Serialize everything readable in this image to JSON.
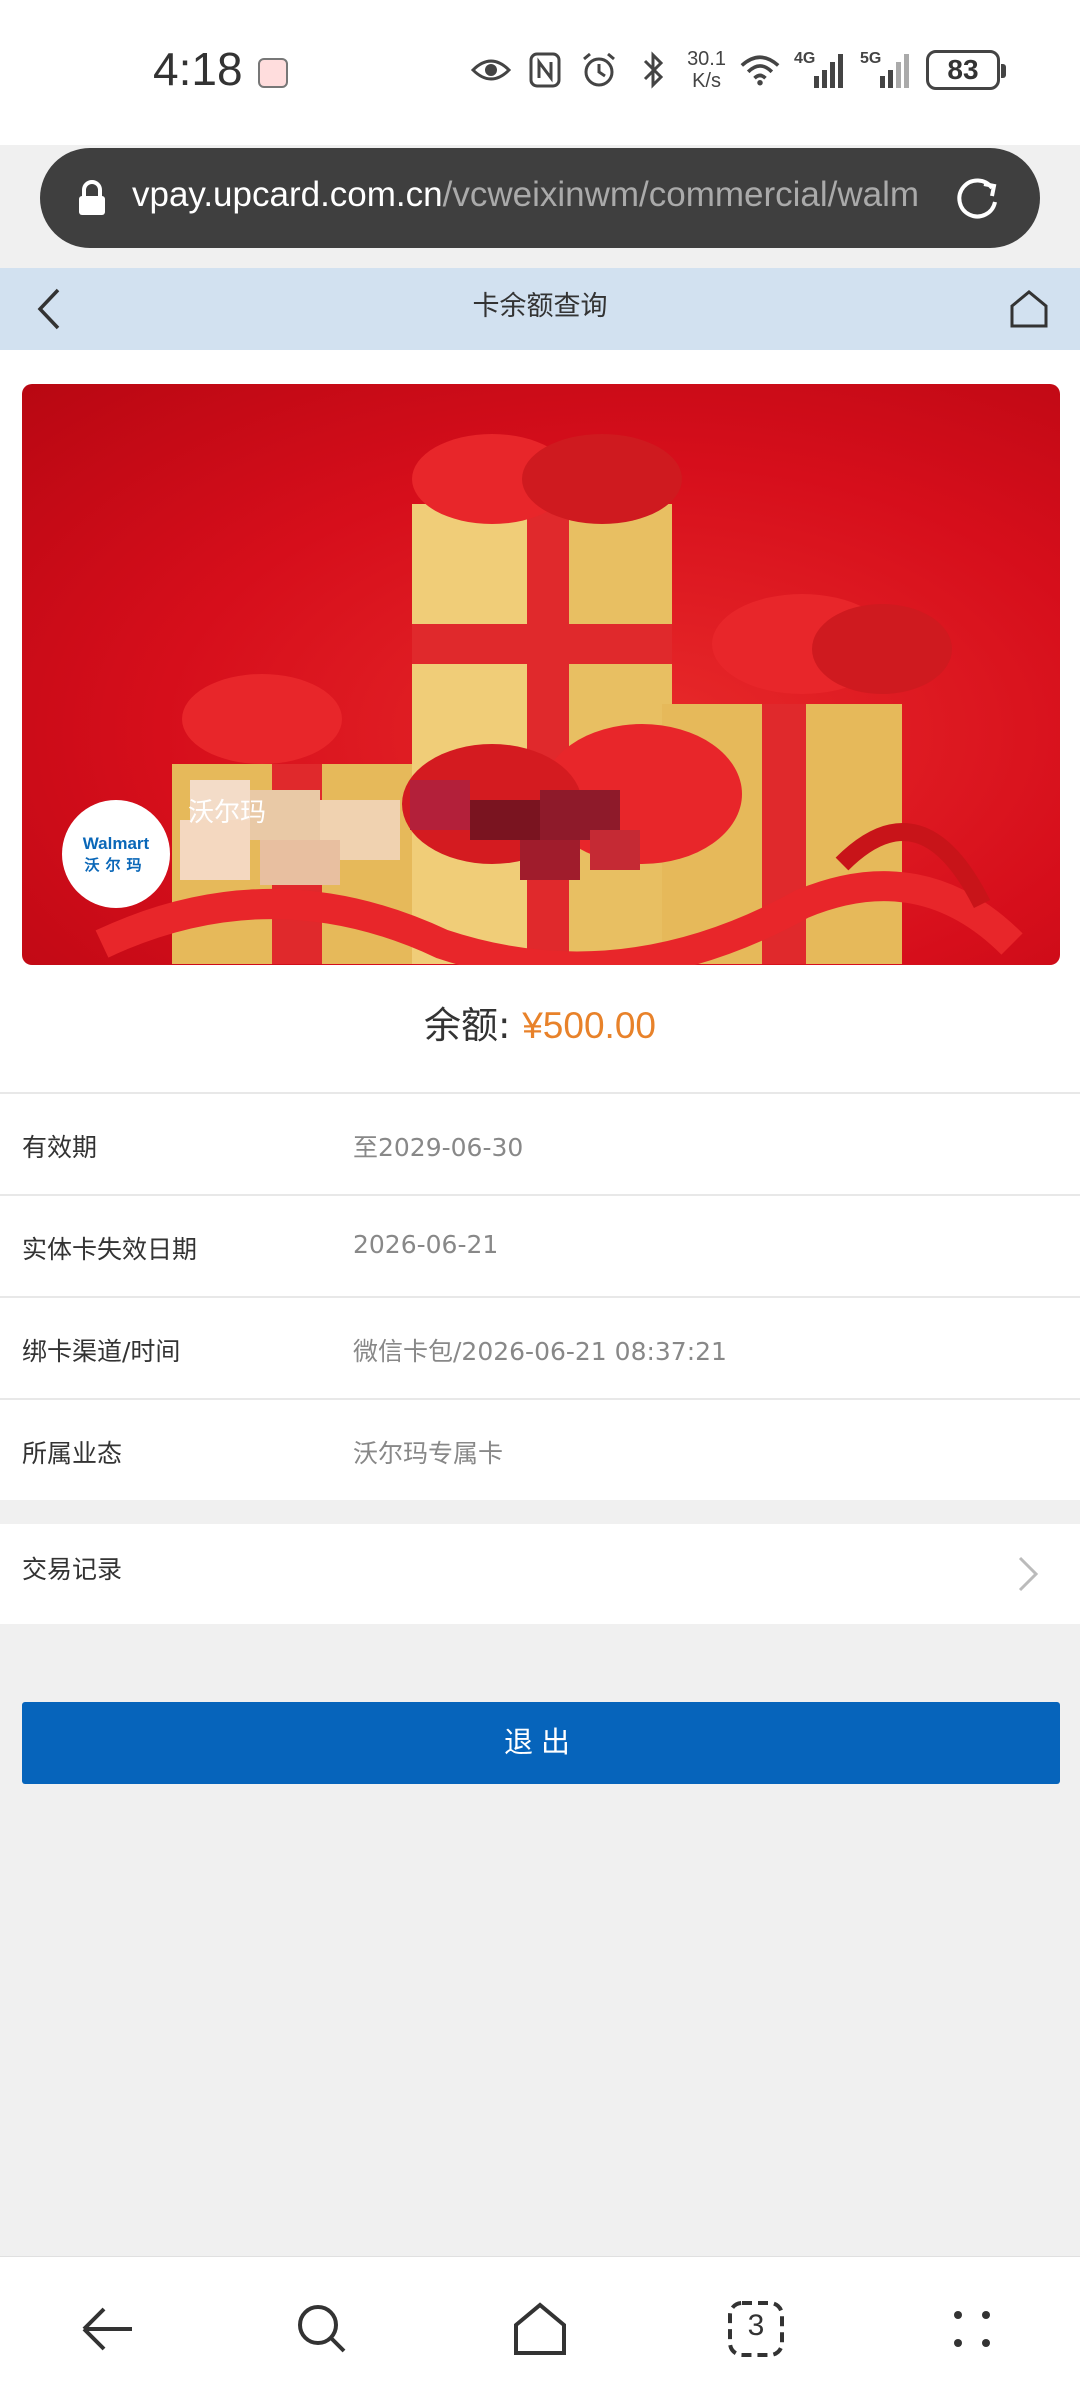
{
  "status_bar": {
    "time": "4:18",
    "speed_value": "30.1",
    "speed_unit": "K/s",
    "net_4g": "4G",
    "net_5g": "5G",
    "battery": "83"
  },
  "browser": {
    "url_host": "vpay.upcard.com.cn",
    "url_path": "/vcweixinwm/commercial/walm"
  },
  "header": {
    "title": "卡余额查询"
  },
  "card": {
    "logo_en": "Walmart",
    "logo_cn": "沃尔玛",
    "name_partial": "沃尔玛"
  },
  "balance": {
    "label": "余额:",
    "value": "¥500.00"
  },
  "details": [
    {
      "label": "有效期",
      "value": "至2029-06-30"
    },
    {
      "label": "实体卡失效日期",
      "value": "2026-06-21"
    },
    {
      "label": "绑卡渠道/时间",
      "value": "微信卡包/2026-06-21 08:37:21"
    },
    {
      "label": "所属业态",
      "value": "沃尔玛专属卡"
    }
  ],
  "transactions": {
    "label": "交易记录"
  },
  "logout": {
    "label": "退出"
  },
  "colors": {
    "header_bg": "#d2e1f0",
    "balance_value": "#e8822a",
    "primary_button": "#0664bb",
    "card_red": "#d60e1b"
  },
  "nav_icons": [
    "back-arrow-icon",
    "search-icon",
    "home-icon",
    "tabs-icon",
    "menu-icon"
  ],
  "nav_tab_count": "3"
}
